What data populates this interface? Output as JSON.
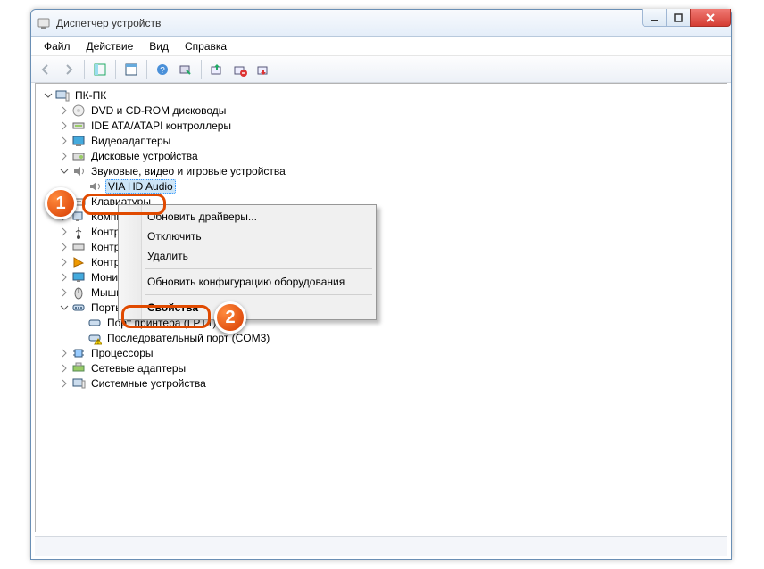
{
  "window": {
    "title": "Диспетчер устройств"
  },
  "menus": {
    "file": "Файл",
    "action": "Действие",
    "view": "Вид",
    "help": "Справка"
  },
  "tree": {
    "root": "ПК-ПК",
    "dvd": "DVD и CD-ROM дисководы",
    "ide": "IDE ATA/ATAPI контроллеры",
    "video": "Видеоадаптеры",
    "disk": "Дисковые устройства",
    "sound_cat": "Звуковые, видео и игровые устройства",
    "via_hd": "VIA HD Audio",
    "keyboards": "Клавиатуры",
    "computer": "Компьютер",
    "usb": "Контроллеры USB",
    "floppy": "Контроллеры гибких дисков",
    "storage": "Контроллеры запоминающих устройств",
    "monitors": "Мониторы",
    "mice": "Мыши и иные указывающие устройства",
    "ports": "Порты (COM и LPT)",
    "lpt1": "Порт принтера (LPT1)",
    "com3": "Последовательный порт (COM3)",
    "cpu": "Процессоры",
    "net": "Сетевые адаптеры",
    "system": "Системные устройства"
  },
  "context_menu": {
    "update": "Обновить драйверы...",
    "disable": "Отключить",
    "uninstall": "Удалить",
    "scan": "Обновить конфигурацию оборудования",
    "properties": "Свойства"
  },
  "markers": {
    "m1": "1",
    "m2": "2"
  }
}
